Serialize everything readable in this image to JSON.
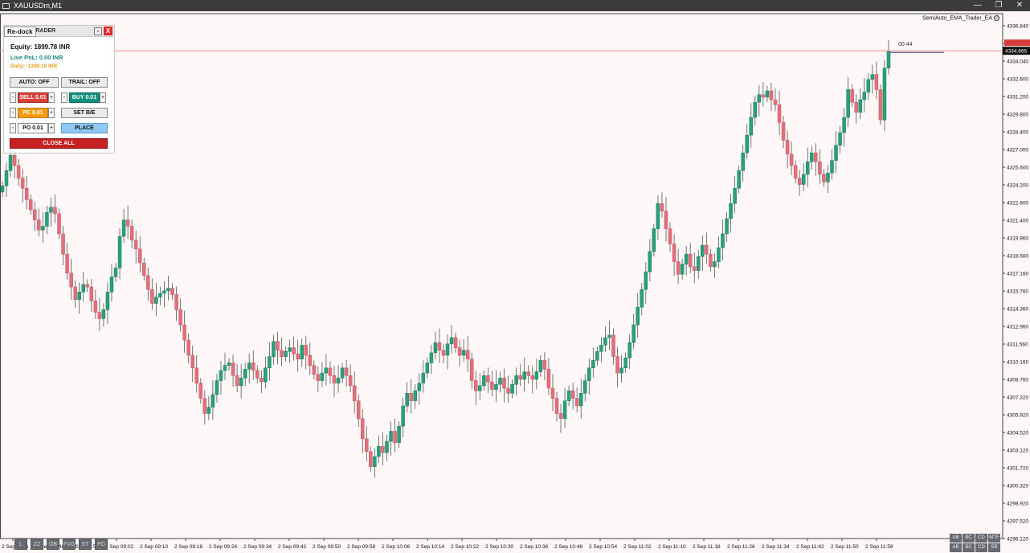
{
  "window": {
    "title": "XAUUSDm,M1",
    "buttons": [
      "—",
      "❐",
      "✕"
    ]
  },
  "chart": {
    "symbol_label": "SemiAuto_EMA_Trader_EA",
    "timer": "00:44",
    "current_price": "4334.665",
    "colors": {
      "bull": "#26a17a",
      "bear": "#e2707a",
      "bg": "#fdf8f7",
      "price_line": "#f0877f",
      "marker": "#2d3a8c"
    },
    "price_labels": [
      "4336.840",
      "4335.440",
      "4334.040",
      "4332.600",
      "4331.200",
      "4329.800",
      "4328.400",
      "4327.000",
      "4325.600",
      "4324.200",
      "4322.800",
      "4321.400",
      "4319.960",
      "4318.560",
      "4317.160",
      "4315.760",
      "4314.360",
      "4312.960",
      "4311.560",
      "4310.160",
      "4308.760",
      "4307.320",
      "4305.920",
      "4304.520",
      "4303.120",
      "4301.720",
      "4300.320",
      "4298.920",
      "4297.520",
      "4296.120"
    ],
    "time_labels": [
      "2 Sep 2026",
      "2 Sep 08:46",
      "2 Sep 08:54",
      "2 Sep 09:02",
      "2 Sep 09:10",
      "2 Sep 09:18",
      "2 Sep 09:26",
      "2 Sep 09:34",
      "2 Sep 09:42",
      "2 Sep 09:50",
      "2 Sep 09:58",
      "2 Sep 10:06",
      "2 Sep 10:14",
      "2 Sep 10:22",
      "2 Sep 10:30",
      "2 Sep 10:38",
      "2 Sep 10:46",
      "2 Sep 10:54",
      "2 Sep 11:02",
      "2 Sep 11:10",
      "2 Sep 11:18",
      "2 Sep 11:26",
      "2 Sep 11:34",
      "2 Sep 11:42",
      "2 Sep 11:50",
      "2 Sep 11:58"
    ]
  },
  "chart_data": {
    "type": "candlestick",
    "y_range": [
      4296.12,
      4337.6
    ],
    "closes": [
      4324.0,
      4325.2,
      4326.4,
      4325.6,
      4324.6,
      4323.8,
      4322.9,
      4322.1,
      4321.3,
      4320.5,
      4320.8,
      4321.9,
      4322.3,
      4321.8,
      4320.2,
      4318.6,
      4317.1,
      4316.0,
      4315.0,
      4315.6,
      4316.2,
      4316.0,
      4314.9,
      4314.0,
      4313.5,
      4314.2,
      4315.6,
      4316.8,
      4317.5,
      4320.0,
      4321.3,
      4320.8,
      4319.7,
      4319.0,
      4317.9,
      4316.9,
      4315.8,
      4314.7,
      4315.2,
      4315.5,
      4315.7,
      4315.9,
      4315.4,
      4314.2,
      4313.0,
      4311.8,
      4310.6,
      4309.6,
      4308.4,
      4307.2,
      4306.0,
      4306.5,
      4307.5,
      4308.6,
      4309.4,
      4309.8,
      4310.0,
      4309.0,
      4308.2,
      4308.8,
      4309.5,
      4310.0,
      4309.4,
      4308.8,
      4308.5,
      4309.6,
      4310.5,
      4311.7,
      4311.0,
      4310.5,
      4310.9,
      4311.2,
      4310.7,
      4310.3,
      4311.4,
      4310.6,
      4309.8,
      4309.1,
      4308.6,
      4309.2,
      4309.6,
      4309.0,
      4308.4,
      4308.8,
      4309.6,
      4309.0,
      4308.2,
      4307.0,
      4305.6,
      4304.0,
      4303.0,
      4301.8,
      4302.6,
      4303.4,
      4302.9,
      4303.8,
      4304.6,
      4303.7,
      4305.0,
      4306.6,
      4307.6,
      4307.0,
      4307.8,
      4308.4,
      4309.2,
      4310.0,
      4310.8,
      4311.6,
      4311.0,
      4310.6,
      4311.5,
      4312.0,
      4311.2,
      4310.6,
      4311.0,
      4310.3,
      4308.6,
      4307.8,
      4308.2,
      4309.0,
      4308.5,
      4307.9,
      4308.3,
      4308.8,
      4308.0,
      4307.6,
      4308.3,
      4309.0,
      4308.7,
      4309.3,
      4309.0,
      4308.7,
      4309.3,
      4310.2,
      4309.5,
      4308.0,
      4307.2,
      4306.0,
      4305.6,
      4307.0,
      4307.8,
      4307.2,
      4306.6,
      4307.6,
      4308.6,
      4309.6,
      4310.2,
      4310.9,
      4311.4,
      4312.0,
      4312.2,
      4310.5,
      4309.2,
      4309.6,
      4310.4,
      4311.6,
      4313.0,
      4314.4,
      4315.8,
      4317.2,
      4318.8,
      4320.6,
      4322.6,
      4322.0,
      4320.6,
      4319.4,
      4318.0,
      4317.0,
      4317.8,
      4318.6,
      4317.6,
      4317.3,
      4318.4,
      4319.3,
      4318.6,
      4317.6,
      4318.0,
      4319.1,
      4320.2,
      4321.4,
      4322.6,
      4323.8,
      4325.2,
      4326.6,
      4328.0,
      4329.4,
      4330.6,
      4331.2,
      4331.0,
      4331.5,
      4330.8,
      4330.4,
      4329.0,
      4327.6,
      4326.5,
      4325.6,
      4324.6,
      4324.1,
      4324.9,
      4325.9,
      4326.6,
      4325.9,
      4324.9,
      4324.3,
      4325.0,
      4326.0,
      4327.2,
      4328.2,
      4329.4,
      4331.6,
      4330.6,
      4329.8,
      4330.8,
      4331.4,
      4332.4,
      4332.8,
      4331.6,
      4329.2,
      4333.3,
      4334.665
    ]
  },
  "panel": {
    "title": "SEMI TRADER",
    "redock_label": "Re-dock",
    "minimize_label": "-",
    "close_label": "X",
    "equity": "Equity: 1899.78 INR",
    "live_pnl": "Live PnL: 0.00 INR",
    "daily": "Daily: -1390.16 INR",
    "auto_label": "AUTO: OFF",
    "trail_label": "TRAIL: OFF",
    "sell_label": "SELL 0.01",
    "buy_label": "BUY 0.01",
    "pc_label": "PC 0.01",
    "setbe_label": "SET B/E",
    "po_label": "PO 0.01",
    "place_label": "PLACE",
    "closeall_label": "CLOSE ALL",
    "minus": "-",
    "plus": "+",
    "colors": {
      "sell": "#d9403a",
      "buy": "#11907f",
      "pc": "#f39c12",
      "place": "#8fc8f3",
      "closeall": "#c62020",
      "equity": "#111111",
      "pnl": "#11907f",
      "daily": "#f39c12"
    }
  },
  "bottom_tools": [
    "L",
    "ZZ",
    "OB",
    "FVG",
    "ST",
    "PD"
  ],
  "right_tools": [
    "AB",
    "BC",
    "CD",
    "MTF",
    "AB",
    "BC",
    "CD",
    "SR"
  ]
}
